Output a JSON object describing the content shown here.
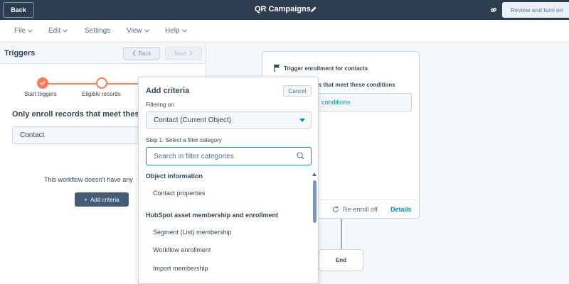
{
  "topbar": {
    "back_label": "Back",
    "title": "QR Campaigns",
    "review_label": "Review and turn on"
  },
  "menu": {
    "items": [
      {
        "label": "File",
        "has_dropdown": true
      },
      {
        "label": "Edit",
        "has_dropdown": true
      },
      {
        "label": "Settings",
        "has_dropdown": false
      },
      {
        "label": "View",
        "has_dropdown": true
      },
      {
        "label": "Help",
        "has_dropdown": true
      }
    ]
  },
  "left_panel": {
    "title": "Triggers",
    "back_label": "Back",
    "next_label": "Next",
    "steps": [
      "Start triggers",
      "Eligible records"
    ],
    "heading": "Only enroll records that meet these",
    "object_value": "Contact",
    "empty_text": "This workflow doesn't have any",
    "add_criteria_label": "Add criteria"
  },
  "canvas": {
    "trigger_title": "Trigger enrollment for contacts",
    "conditions_text": "ts that meet these conditions",
    "conditions_box": "conditions",
    "reenroll_text": "Re-enroll off",
    "details_label": "Details",
    "end_label": "End"
  },
  "popover": {
    "title": "Add criteria",
    "cancel_label": "Cancel",
    "filter_label": "Filtering on",
    "object_selected": "Contact (Current Object)",
    "step_text": "Step 1: Select a filter category",
    "search_placeholder": "Search in filter categories",
    "categories": [
      {
        "heading": "Object information",
        "items": [
          "Contact properties"
        ]
      },
      {
        "heading": "HubSpot asset membership and enrollment",
        "items": [
          "Segment (List) membership",
          "Workflow enrollment",
          "Import membership"
        ]
      }
    ]
  },
  "colors": {
    "topbar": "#2d3e50",
    "accent": "#ff7a59",
    "link": "#0091ae",
    "primary_button": "#425b76"
  }
}
